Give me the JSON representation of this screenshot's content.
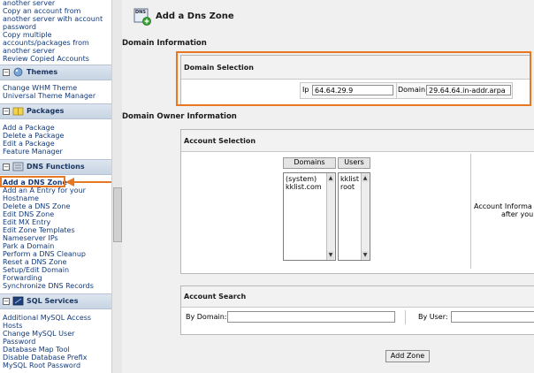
{
  "sidebar": {
    "top_links": [
      "another server",
      "Copy an account from",
      "another server with account",
      "password",
      "Copy multiple",
      "accounts/packages from",
      "another server",
      "Review Copied Accounts"
    ],
    "themes": {
      "title": "Themes",
      "links": [
        "Change WHM Theme",
        "Universal Theme Manager"
      ]
    },
    "packages": {
      "title": "Packages",
      "links": [
        "Add a Package",
        "Delete a Package",
        "Edit a Package",
        "Feature Manager"
      ]
    },
    "dns": {
      "title": "DNS Functions",
      "links": [
        "Add a DNS Zone",
        "Add an A Entry for your",
        "Hostname",
        "Delete a DNS Zone",
        "Edit DNS Zone",
        "Edit MX Entry",
        "Edit Zone Templates",
        "Nameserver IPs",
        "Park a Domain",
        "Perform a DNS Cleanup",
        "Reset a DNS Zone",
        "Setup/Edit Domain",
        "Forwarding",
        "Synchronize DNS Records"
      ]
    },
    "sql": {
      "title": "SQL Services",
      "links": [
        "Additional MySQL Access",
        "Hosts",
        "Change MySQL User",
        "Password",
        "Database Map Tool",
        "Disable Database Prefix",
        "MySQL Root Password"
      ]
    }
  },
  "main": {
    "icon_label": "DNS",
    "title": "Add a Dns Zone",
    "domain_info_title": "Domain Information",
    "domain_selection_title": "Domain Selection",
    "ip_label": "Ip",
    "ip_value": "64.64.29.9",
    "domain_label": "Domain",
    "domain_value": "29.64.64.in-addr.arpa",
    "owner_info_title": "Domain Owner Information",
    "account_selection_title": "Account Selection",
    "domains_header": "Domains",
    "users_header": "Users",
    "domains_items": [
      "(system)",
      "kklist.com"
    ],
    "users_items": [
      "kklist",
      "root"
    ],
    "account_info_line1": "Account Informa",
    "account_info_line2": "after you",
    "account_search_title": "Account Search",
    "by_domain_label": "By Domain:",
    "by_domain_value": "",
    "by_user_label": "By User:",
    "by_user_value": "",
    "add_zone_button": "Add Zone"
  },
  "colors": {
    "highlight": "#e87722",
    "link": "#123a7c"
  }
}
